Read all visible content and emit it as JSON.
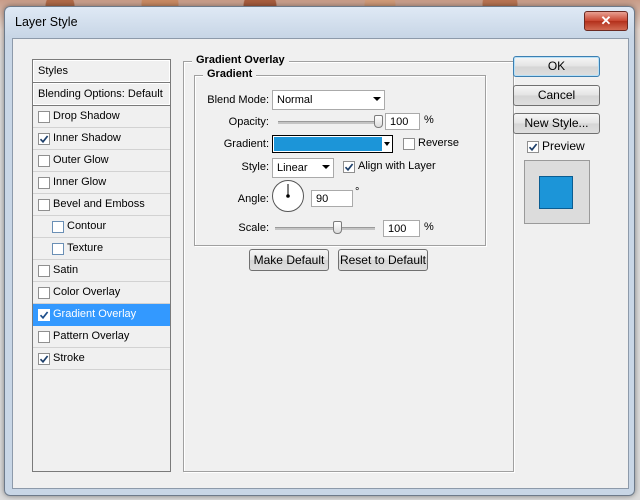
{
  "window": {
    "title": "Layer Style",
    "close_glyph": "✕"
  },
  "styles_panel": {
    "header": "Styles",
    "blending_options": "Blending Options: Default",
    "items": [
      {
        "label": "Drop Shadow",
        "checked": false,
        "indent": false,
        "selected": false
      },
      {
        "label": "Inner Shadow",
        "checked": true,
        "indent": false,
        "selected": false
      },
      {
        "label": "Outer Glow",
        "checked": false,
        "indent": false,
        "selected": false
      },
      {
        "label": "Inner Glow",
        "checked": false,
        "indent": false,
        "selected": false
      },
      {
        "label": "Bevel and Emboss",
        "checked": false,
        "indent": false,
        "selected": false
      },
      {
        "label": "Contour",
        "checked": false,
        "indent": true,
        "selected": false
      },
      {
        "label": "Texture",
        "checked": false,
        "indent": true,
        "selected": false
      },
      {
        "label": "Satin",
        "checked": false,
        "indent": false,
        "selected": false
      },
      {
        "label": "Color Overlay",
        "checked": false,
        "indent": false,
        "selected": false
      },
      {
        "label": "Gradient Overlay",
        "checked": true,
        "indent": false,
        "selected": true
      },
      {
        "label": "Pattern Overlay",
        "checked": false,
        "indent": false,
        "selected": false
      },
      {
        "label": "Stroke",
        "checked": true,
        "indent": false,
        "selected": false
      }
    ]
  },
  "gradient_overlay": {
    "section_title": "Gradient Overlay",
    "group_title": "Gradient",
    "blend_mode_label": "Blend Mode:",
    "blend_mode_value": "Normal",
    "opacity_label": "Opacity:",
    "opacity_value": "100",
    "opacity_fraction": 1.0,
    "percent": "%",
    "gradient_label": "Gradient:",
    "gradient_color": "#1c95d8",
    "reverse_label": "Reverse",
    "reverse_checked": false,
    "style_label": "Style:",
    "style_value": "Linear",
    "align_label": "Align with Layer",
    "align_checked": true,
    "angle_label": "Angle:",
    "angle_value": "90",
    "degree": "°",
    "scale_label": "Scale:",
    "scale_value": "100",
    "scale_fraction": 0.62,
    "make_default": "Make Default",
    "reset_default": "Reset to Default"
  },
  "actions": {
    "ok": "OK",
    "cancel": "Cancel",
    "new_style": "New Style...",
    "preview_label": "Preview",
    "preview_checked": true,
    "preview_color": "#1c95d8"
  }
}
